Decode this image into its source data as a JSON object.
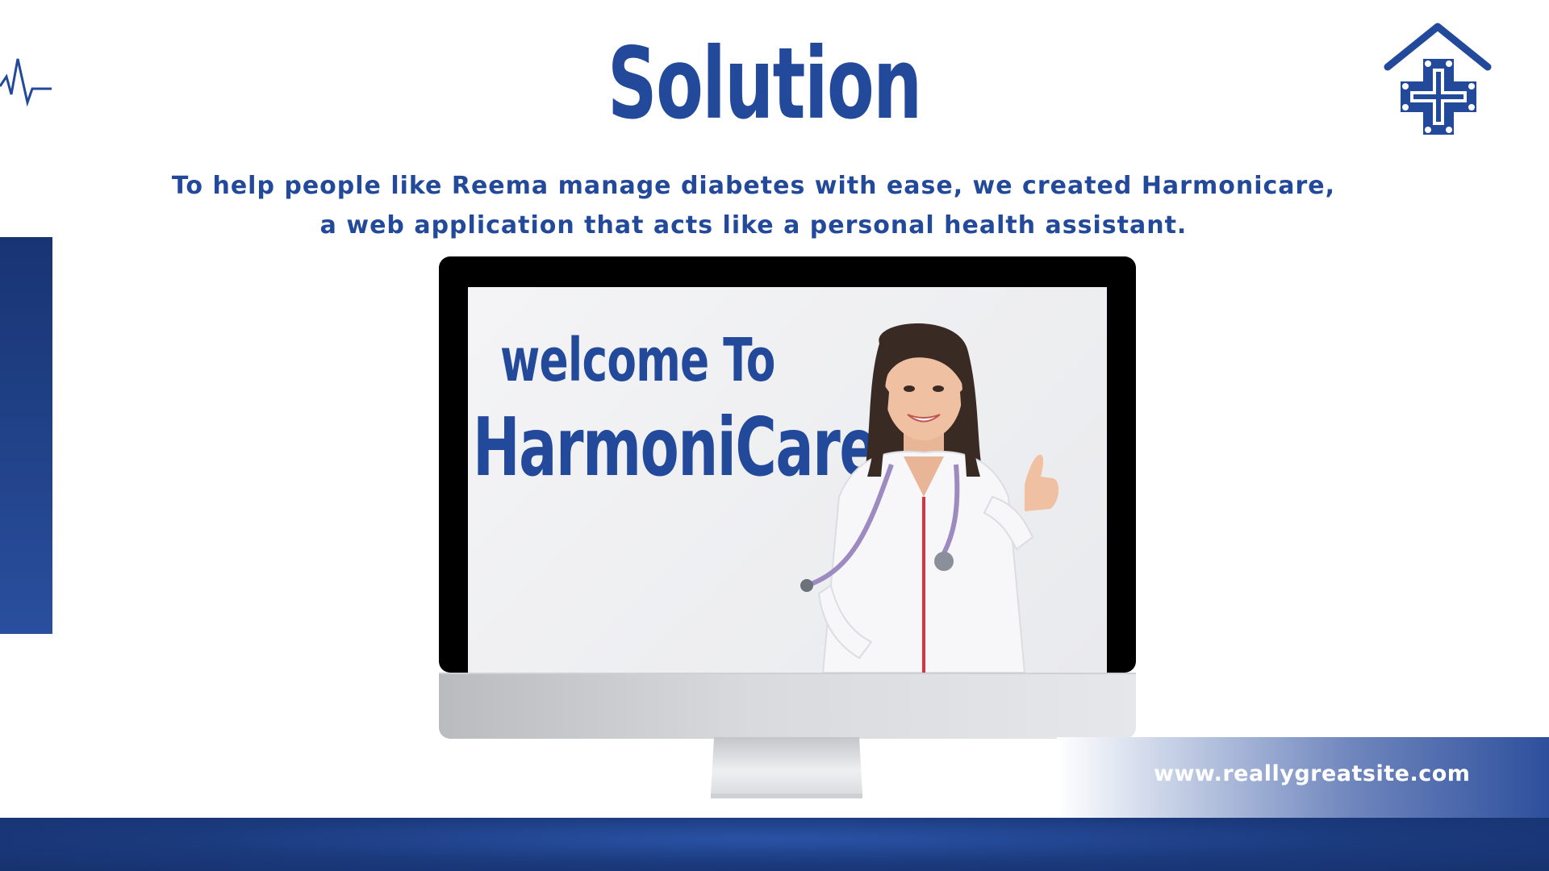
{
  "slide": {
    "title": "Solution",
    "subtitle_line1": "To help people like Reema manage diabetes with ease, we created Harmonicare,",
    "subtitle_line2": "a web application that acts like a personal health assistant.",
    "url": "www.reallygreatsite.com"
  },
  "monitor": {
    "welcome": "welcome To",
    "brand": "HarmoniCare"
  },
  "icons": {
    "top_left": "heartbeat-icon",
    "top_right": "medical-home-logo-icon"
  },
  "colors": {
    "primary": "#23499a",
    "dark_navy": "#16326e",
    "background": "#ffffff"
  }
}
